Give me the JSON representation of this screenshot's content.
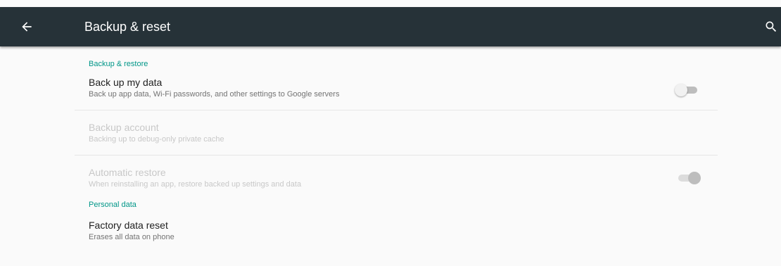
{
  "toolbar": {
    "title": "Backup & reset",
    "back_icon": "arrow-back-icon",
    "search_icon": "search-icon",
    "background": "#263238"
  },
  "sections": {
    "backup_restore": {
      "header": "Backup & restore",
      "backup_my_data": {
        "title": "Back up my data",
        "summary": "Back up app data, Wi-Fi passwords, and other settings to Google servers",
        "switch_on": false
      },
      "backup_account": {
        "title": "Backup account",
        "summary": "Backing up to debug-only private cache"
      },
      "automatic_restore": {
        "title": "Automatic restore",
        "summary": "When reinstalling an app, restore backed up settings and data",
        "switch_on": true
      }
    },
    "personal_data": {
      "header": "Personal data",
      "factory_reset": {
        "title": "Factory data reset",
        "summary": "Erases all data on phone"
      }
    }
  },
  "colors": {
    "accent": "#009688",
    "disabled_text": "#c8c8c8"
  }
}
